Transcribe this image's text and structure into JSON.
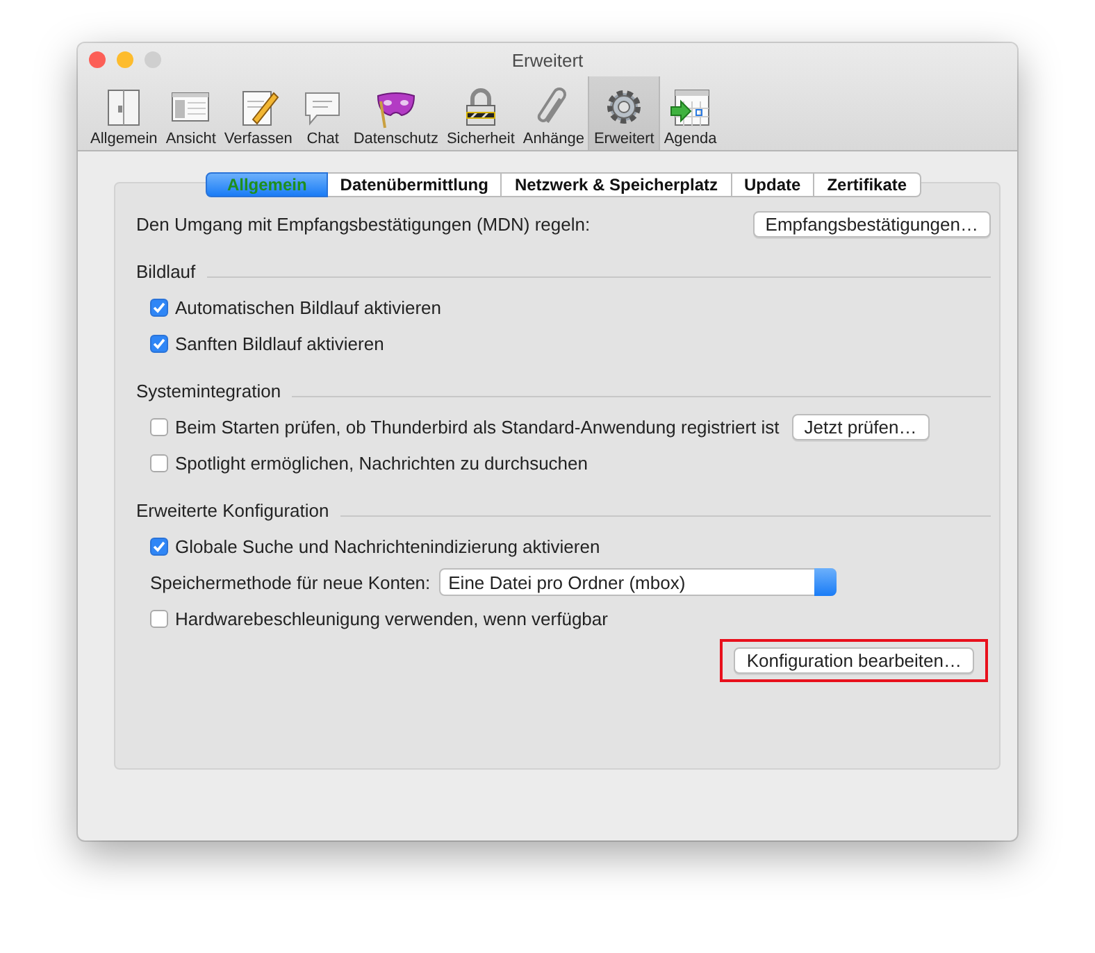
{
  "window": {
    "title": "Erweitert"
  },
  "toolbar": [
    {
      "label": "Allgemein",
      "selected": false
    },
    {
      "label": "Ansicht",
      "selected": false
    },
    {
      "label": "Verfassen",
      "selected": false
    },
    {
      "label": "Chat",
      "selected": false
    },
    {
      "label": "Datenschutz",
      "selected": false
    },
    {
      "label": "Sicherheit",
      "selected": false
    },
    {
      "label": "Anhänge",
      "selected": false
    },
    {
      "label": "Erweitert",
      "selected": true
    },
    {
      "label": "Agenda",
      "selected": false
    }
  ],
  "tabs": [
    {
      "label": "Allgemein",
      "selected": true
    },
    {
      "label": "Datenübermittlung",
      "selected": false
    },
    {
      "label": "Netzwerk & Speicherplatz",
      "selected": false
    },
    {
      "label": "Update",
      "selected": false
    },
    {
      "label": "Zertifikate",
      "selected": false
    }
  ],
  "rows": [
    {
      "kind": "label_button",
      "text": "Den Umgang mit Empfangsbestätigungen (MDN) regeln:",
      "button": "Empfangsbestätigungen…"
    },
    {
      "kind": "section",
      "title": "Bildlauf"
    },
    {
      "kind": "checkbox",
      "label": "Automatischen Bildlauf aktivieren",
      "checked": true
    },
    {
      "kind": "checkbox",
      "label": "Sanften Bildlauf aktivieren",
      "checked": true
    },
    {
      "kind": "section",
      "title": "Systemintegration"
    },
    {
      "kind": "checkbox",
      "label": "Beim Starten prüfen, ob Thunderbird als Standard-Anwendung registriert ist",
      "checked": false,
      "button": "Jetzt prüfen…"
    },
    {
      "kind": "checkbox",
      "label": "Spotlight ermöglichen, Nachrichten zu durchsuchen",
      "checked": false
    },
    {
      "kind": "section",
      "title": "Erweiterte Konfiguration"
    },
    {
      "kind": "checkbox",
      "label": "Globale Suche und Nachrichtenindizierung aktivieren",
      "checked": true
    },
    {
      "kind": "select",
      "label": "Speichermethode für neue Konten:",
      "value": "Eine Datei pro Ordner (mbox)"
    },
    {
      "kind": "checkbox",
      "label": "Hardwarebeschleunigung verwenden, wenn verfügbar",
      "checked": false
    },
    {
      "kind": "button",
      "label": "Konfiguration bearbeiten…",
      "highlighted": true
    }
  ]
}
